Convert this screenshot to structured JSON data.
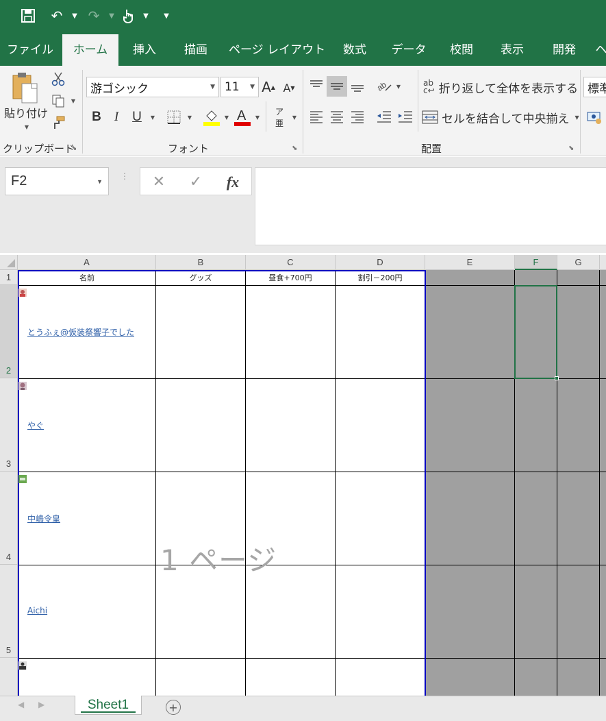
{
  "tabs": [
    "ファイル",
    "ホーム",
    "挿入",
    "描画",
    "ページ レイアウト",
    "数式",
    "データ",
    "校閲",
    "表示",
    "開発",
    "ヘ"
  ],
  "ribbon": {
    "paste_label": "貼り付け",
    "clipboard_label": "クリップボード",
    "font_label": "フォント",
    "alignment_label": "配置",
    "font_name": "游ゴシック",
    "font_size": "11",
    "wrap_text": "折り返して全体を表示する",
    "merge_center": "セルを結合して中央揃え",
    "number_format": "標準",
    "bold": "B",
    "italic": "I",
    "underline": "U"
  },
  "formula_bar": {
    "name_box": "F2",
    "fx": "fx",
    "value": ""
  },
  "grid": {
    "columns": [
      "A",
      "B",
      "C",
      "D",
      "E",
      "F",
      "G"
    ],
    "rows": [
      "1",
      "2",
      "3",
      "4",
      "5"
    ],
    "selected_cell": "F2",
    "headers": [
      "名前",
      "グッズ",
      "昼食+700円",
      "割引－200円"
    ],
    "names": [
      "とうふぇ@仮装祭響子でした",
      "やぐ",
      "中嶋令皇",
      "Aichi"
    ],
    "page_watermark": "1 ページ"
  },
  "sheets": [
    "Sheet1"
  ],
  "colors": {
    "excel_green": "#217346",
    "link_blue": "#2e5fa8",
    "page_break_blue": "#0000c0"
  }
}
